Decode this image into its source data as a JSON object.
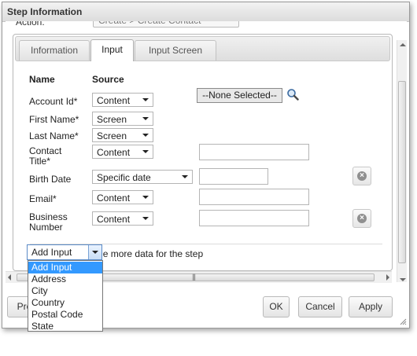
{
  "dialog": {
    "title": "Step Information"
  },
  "cut_row": {
    "label": "Action:",
    "value": "Create > Create Contact"
  },
  "tabs": [
    {
      "label": "Information",
      "active": false
    },
    {
      "label": "Input",
      "active": true
    },
    {
      "label": "Input Screen",
      "active": false
    }
  ],
  "columns": {
    "name": "Name",
    "source": "Source"
  },
  "fields": [
    {
      "label": "Account Id*",
      "source": "Content",
      "value": "--None Selected--",
      "has_lookup": true,
      "has_delete": false
    },
    {
      "label": "First Name*",
      "source": "Screen"
    },
    {
      "label": "Last Name*",
      "source": "Screen"
    },
    {
      "label": "Contact Title*",
      "label_line1": "Contact",
      "label_line2": "Title*",
      "source": "Content",
      "value": ""
    },
    {
      "label": "Birth Date",
      "source": "Specific date",
      "value": "",
      "has_delete": true
    },
    {
      "label": "Email*",
      "source": "Content",
      "value": ""
    },
    {
      "label": "Business Number",
      "label_line1": "Business",
      "label_line2": "Number",
      "source": "Content",
      "value": "",
      "has_delete": true
    }
  ],
  "hint": "Use this to provide more data for the step",
  "add_input": {
    "selected": "Add Input",
    "options": [
      "Add Input",
      "Address",
      "City",
      "Country",
      "Postal Code",
      "State"
    ],
    "highlighted_index": 0
  },
  "footer": {
    "prev_label": "Pre",
    "ok_label": "OK",
    "cancel_label": "Cancel",
    "apply_label": "Apply"
  },
  "colors": {
    "highlight": "#3399ff",
    "panel_border": "#b8b8b8"
  }
}
